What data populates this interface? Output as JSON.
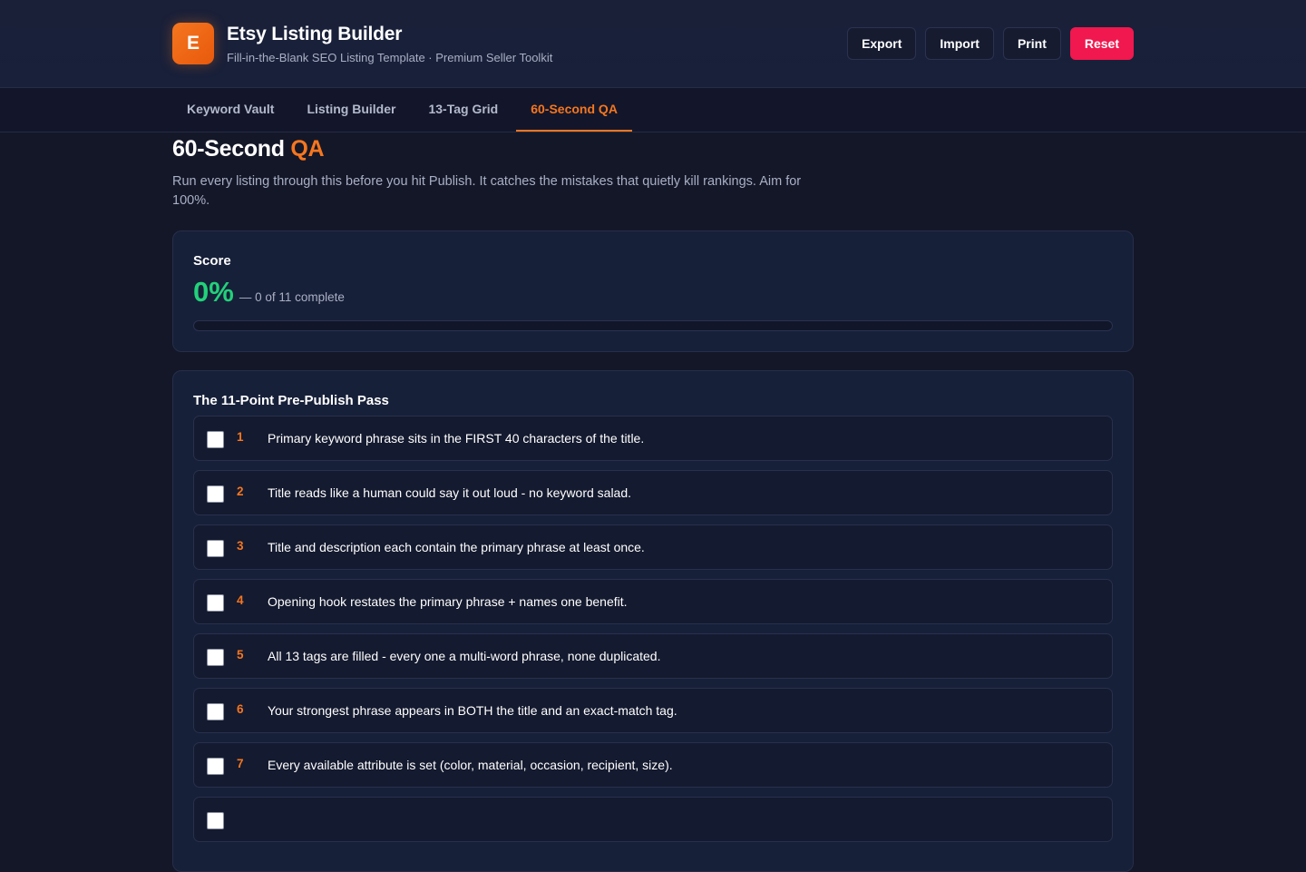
{
  "app": {
    "logo_letter": "E",
    "title": "Etsy Listing Builder",
    "subtitle": "Fill-in-the-Blank SEO Listing Template · Premium Seller Toolkit"
  },
  "actions": {
    "export": "Export",
    "import": "Import",
    "print": "Print",
    "reset": "Reset"
  },
  "tabs": [
    {
      "label": "Keyword Vault"
    },
    {
      "label": "Listing Builder"
    },
    {
      "label": "13-Tag Grid"
    },
    {
      "label": "60-Second QA",
      "active": true
    }
  ],
  "page": {
    "title_main": "60-Second",
    "title_accent": "QA",
    "description": "Run every listing through this before you hit Publish. It catches the mistakes that quietly kill rankings. Aim for 100%."
  },
  "score": {
    "label": "Score",
    "value": "0%",
    "detail": "— 0 of 11 complete",
    "progress_percent": 0
  },
  "checklist": {
    "title": "The 11-Point Pre-Publish Pass",
    "items": [
      {
        "num": "1",
        "text": "Primary keyword phrase sits in the FIRST 40 characters of the title."
      },
      {
        "num": "2",
        "text": "Title reads like a human could say it out loud - no keyword salad."
      },
      {
        "num": "3",
        "text": "Title and description each contain the primary phrase at least once."
      },
      {
        "num": "4",
        "text": "Opening hook restates the primary phrase + names one benefit."
      },
      {
        "num": "5",
        "text": "All 13 tags are filled - every one a multi-word phrase, none duplicated."
      },
      {
        "num": "6",
        "text": "Your strongest phrase appears in BOTH the title and an exact-match tag."
      },
      {
        "num": "7",
        "text": "Every available attribute is set (color, material, occasion, recipient, size)."
      }
    ]
  },
  "colors": {
    "accent": "#f5761f",
    "success": "#22d17a",
    "danger": "#f0184e"
  }
}
